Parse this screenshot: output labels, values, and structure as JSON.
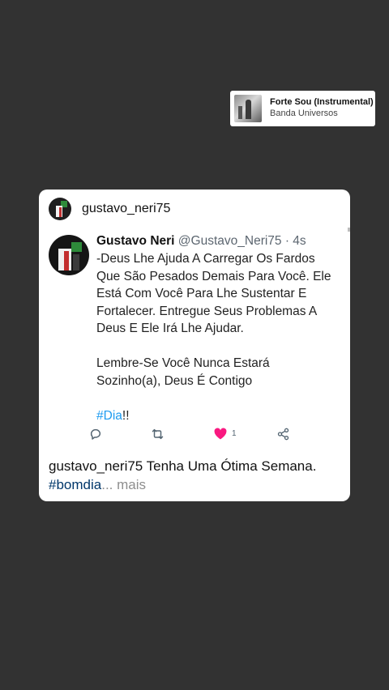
{
  "music": {
    "title": "Forte Sou (Instrumental)",
    "artist": "Banda Universos"
  },
  "post": {
    "username": "gustavo_neri75"
  },
  "tweet": {
    "name": "Gustavo Neri",
    "handle_time": "@Gustavo_Neri75 · 4s",
    "lines": [
      "-Deus Lhe Ajuda A Carregar Os Fardos",
      "Que São Pesados Demais Para Você. Ele",
      "Está Com Você Para Lhe Sustentar E",
      "Fortalecer. Entregue Seus Problemas A",
      "Deus E Ele Irá Lhe Ajudar."
    ],
    "lines2": [
      "Lembre-Se Você Nunca Estará",
      "Sozinho(a), Deus É Contigo"
    ],
    "hashtag": "#Dia",
    "hashtag_suffix": "!!",
    "like_count": "1"
  },
  "caption": {
    "username": "gustavo_neri75",
    "text": " Tenha Uma Ótima Semana.",
    "hashtag": "#bomdia",
    "more": "... mais"
  },
  "colors": {
    "background": "#323232",
    "hashtag": "#1d9bf0",
    "like": "#f91880",
    "caption_tag": "#00376b"
  },
  "icons": [
    "reply-icon",
    "retweet-icon",
    "heart-icon",
    "share-icon"
  ]
}
